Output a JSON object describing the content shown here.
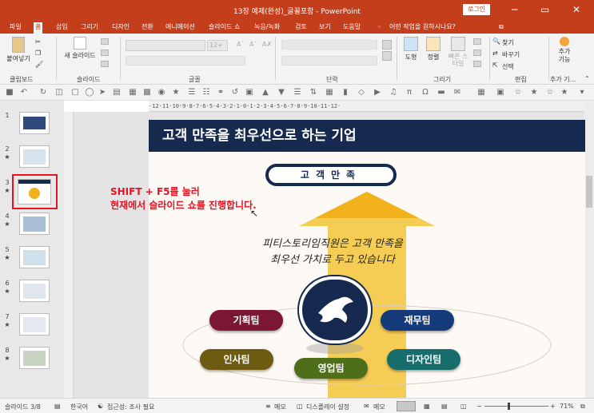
{
  "window": {
    "title": "13장 예제(완성)_글꼴포함 - PowerPoint",
    "login_label": "로그인",
    "minimize_label": "─",
    "restore_label": "▭",
    "close_label": "✕"
  },
  "tabs": [
    {
      "label": "파일"
    },
    {
      "label": "홈"
    },
    {
      "label": "삽입"
    },
    {
      "label": "그리기"
    },
    {
      "label": "디자인"
    },
    {
      "label": "전환"
    },
    {
      "label": "애니메이션"
    },
    {
      "label": "슬라이드 쇼"
    },
    {
      "label": "녹음/녹화"
    },
    {
      "label": "검토"
    },
    {
      "label": "보기"
    },
    {
      "label": "도움말"
    }
  ],
  "tell_me": "어떤 작업을 원하시나요?",
  "ribbon": {
    "groups": {
      "clipboard": "클립보드",
      "slides": "슬라이드",
      "font": "글꼴",
      "paragraph": "단락",
      "drawing": "그리기",
      "editing": "편집",
      "addin": "추가 기..."
    },
    "paste_label": "붙여넣기",
    "new_slide_label": "새 슬라이드",
    "font_size": "12+",
    "shape_label": "도형",
    "arrange_label": "정렬",
    "quick_style_label": "빠른 스타일",
    "find_label": "찾기",
    "replace_label": "바꾸기",
    "select_label": "선택",
    "addin_label": "추가 기능"
  },
  "thumbnails": [
    {
      "num": "1",
      "star": ""
    },
    {
      "num": "2",
      "star": "★"
    },
    {
      "num": "3",
      "star": "★"
    },
    {
      "num": "4",
      "star": "★"
    },
    {
      "num": "5",
      "star": "★"
    },
    {
      "num": "6",
      "star": "★"
    },
    {
      "num": "7",
      "star": "★"
    },
    {
      "num": "8",
      "star": "★"
    }
  ],
  "ruler_text": "·12·11·10·9·8·7·6·5·4·3·2·1·0·1·2·3·4·5·6·7·8·9·10·11·12·",
  "slide": {
    "title": "고객 만족을 최우선으로 하는 기업",
    "pill_text": "고객만족",
    "body_line1": "피티스토리임직원은 고객 만족을",
    "body_line2": "최우선 가치로 두고 있습니다",
    "teams": {
      "planning": "기획팀",
      "finance": "재무팀",
      "hr": "인사팀",
      "design": "디자인팀",
      "sales": "영업팀"
    }
  },
  "annotation": {
    "line1": "SHIFT + F5를 눌러",
    "line2": "현재에서 슬라이드 쇼를 진행합니다."
  },
  "status": {
    "slide_info": "슬라이드 3/8",
    "language": "한국어",
    "accessibility": "접근성: 조사 필요",
    "notes": "메모",
    "display_settings": "디스플레이 설정",
    "comments": "메모",
    "zoom": "71%"
  },
  "colors": {
    "accent": "#c43e1c",
    "slide_title_bg": "#16294f",
    "annotation": "#e81123"
  }
}
